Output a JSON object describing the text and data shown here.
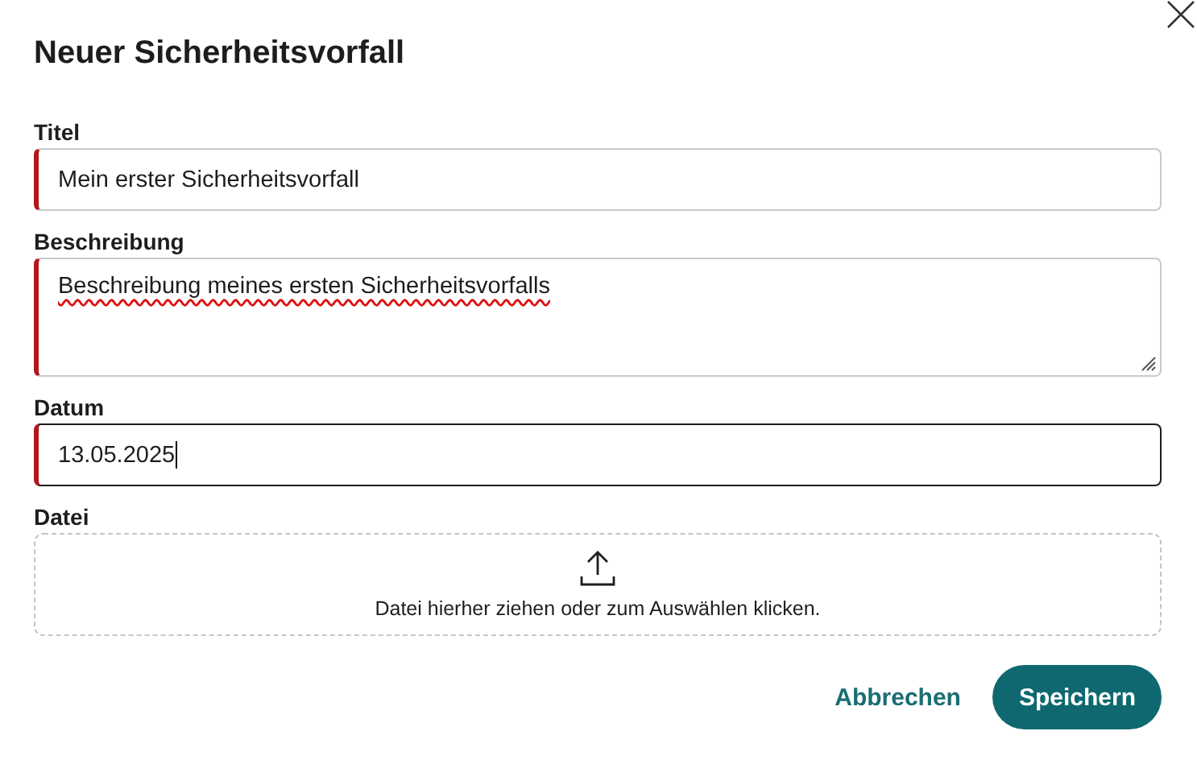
{
  "dialog": {
    "title": "Neuer Sicherheitsvorfall"
  },
  "fields": [
    {
      "kind": "text",
      "label": "Titel",
      "value": "Mein erster Sicherheitsvorfall",
      "required": true,
      "focused": false,
      "spelling_marked": false
    },
    {
      "kind": "textarea",
      "label": "Beschreibung",
      "value": "Beschreibung meines ersten Sicherheitsvorfalls",
      "required": true,
      "focused": false,
      "spelling_marked": true
    },
    {
      "kind": "date",
      "label": "Datum",
      "value": "13.05.2025",
      "required": true,
      "focused": true,
      "spelling_marked": false
    },
    {
      "kind": "file",
      "label": "Datei",
      "hint": "Datei hierher ziehen oder zum Auswählen klicken.",
      "required": false,
      "focused": false
    }
  ],
  "buttons": [
    {
      "kind": "text",
      "label": "Abbrechen"
    },
    {
      "kind": "primary",
      "label": "Speichern"
    }
  ]
}
